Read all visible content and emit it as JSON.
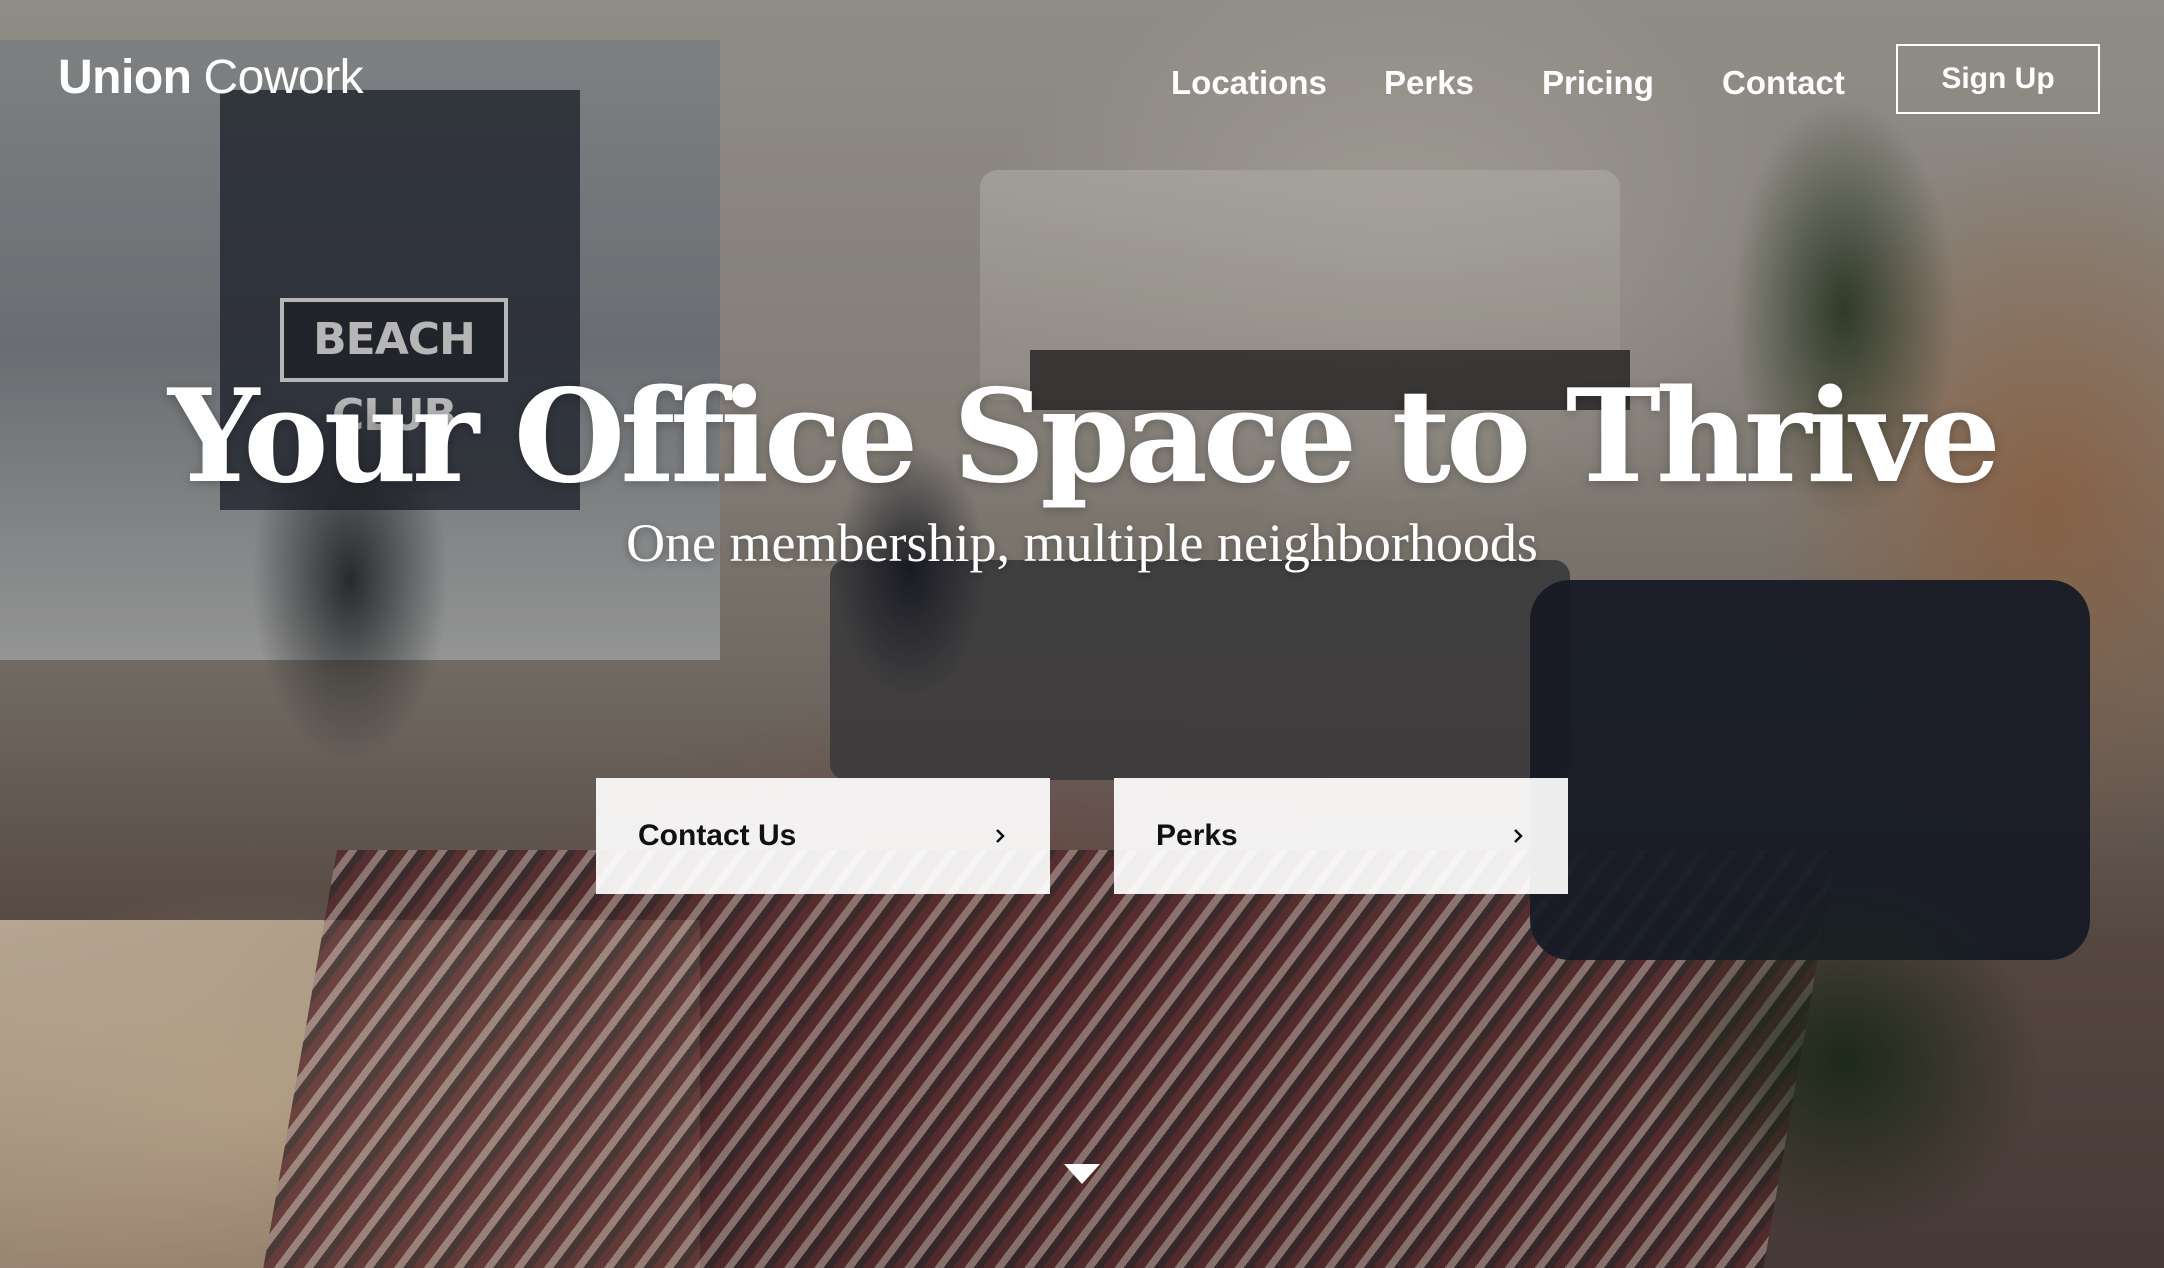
{
  "brand": {
    "name_bold": "Union",
    "name_light": "Cowork"
  },
  "nav": {
    "items": [
      {
        "label": "Locations"
      },
      {
        "label": "Perks"
      },
      {
        "label": "Pricing"
      },
      {
        "label": "Contact"
      }
    ],
    "signup_label": "Sign Up"
  },
  "hero": {
    "headline": "Your Office Space to Thrive",
    "subheadline": "One membership, multiple neighborhoods",
    "background_sign_text": "BEACH CLUB"
  },
  "cta": [
    {
      "label": "Contact Us",
      "icon": "chevron-right-icon"
    },
    {
      "label": "Perks",
      "icon": "chevron-right-icon"
    }
  ],
  "scroll_icon": "triangle-down-icon",
  "colors": {
    "text": "#ffffff",
    "button_bg": "#ffffff",
    "button_text": "#111111"
  }
}
